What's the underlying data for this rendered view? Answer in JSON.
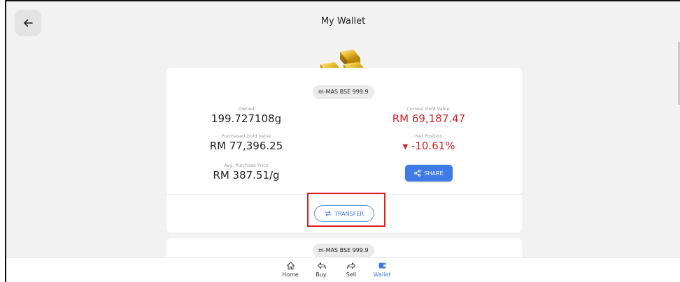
{
  "header": {
    "title": "My Wallet",
    "back_icon": "arrow-left-icon"
  },
  "wallet_card": {
    "product_chip": "m-MAS BSE 999.9",
    "owned_label": "Owned",
    "owned_value": "199.727108g",
    "purchased_value_label": "Purchased Gold Value",
    "purchased_value": "RM 77,396.25",
    "avg_price_label": "Avg. Purchase Price",
    "avg_price_value": "RM 387.51/g",
    "current_value_label": "Current Gold Value:",
    "current_value": "RM 69,187.47",
    "net_position_label": "Net Position",
    "net_position_value": "-10.61%",
    "share_label": "SHARE",
    "transfer_label": "TRANSFER",
    "negative_color": "#d1232a",
    "accent_color": "#3f7be6"
  },
  "wallet_card_2": {
    "product_chip": "m-MAS BSE 999.9"
  },
  "bottom_nav": {
    "items": [
      {
        "label": "Home",
        "icon": "home-icon"
      },
      {
        "label": "Buy",
        "icon": "buy-arrow-icon"
      },
      {
        "label": "Sell",
        "icon": "sell-arrow-icon"
      },
      {
        "label": "Wallet",
        "icon": "wallet-icon",
        "active": true
      }
    ]
  }
}
